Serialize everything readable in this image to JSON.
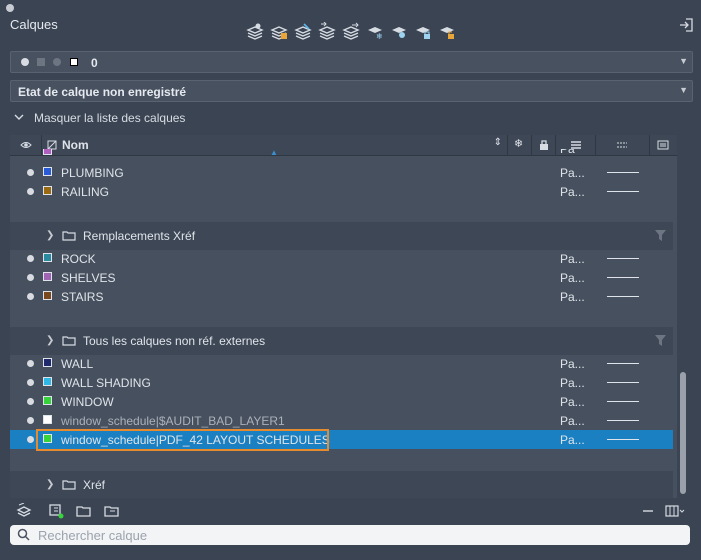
{
  "panel": {
    "title": "Calques"
  },
  "current_layer": {
    "name": "0"
  },
  "state_dropdown": {
    "value": "Etat de calque non enregistré"
  },
  "toggle_list": {
    "label": "Masquer la liste des calques"
  },
  "header": {
    "name": "Nom"
  },
  "rows_top": [
    {
      "name": "PLUMBING",
      "color": "#2a5bd7",
      "plot": "Pa..."
    },
    {
      "name": "RAILING",
      "color": "#9a6a12",
      "plot": "Pa..."
    }
  ],
  "group1": {
    "label": "Remplacements Xréf"
  },
  "rows_mid": [
    {
      "name": "ROCK",
      "color": "#2a8aa0",
      "plot": "Pa..."
    },
    {
      "name": "SHELVES",
      "color": "#a064b4",
      "plot": "Pa..."
    },
    {
      "name": "STAIRS",
      "color": "#7a4a1e",
      "plot": "Pa..."
    }
  ],
  "group2": {
    "label": "Tous les calques non réf. externes"
  },
  "rows_bottom": [
    {
      "name": "WALL",
      "color": "#1f2a6e",
      "plot": "Pa..."
    },
    {
      "name": "WALL SHADING",
      "color": "#2fb8e6",
      "plot": "Pa..."
    },
    {
      "name": "WINDOW",
      "color": "#36d43a",
      "plot": "Pa..."
    },
    {
      "name": "window_schedule|$AUDIT_BAD_LAYER1",
      "color": "#ffffff",
      "plot": "Pa..."
    },
    {
      "name": "window_schedule|PDF_42 LAYOUT SCHEDULES",
      "color": "#36d43a",
      "plot": "Pa..."
    }
  ],
  "group3": {
    "label": "Xréf"
  },
  "search": {
    "placeholder": "Rechercher calque"
  }
}
